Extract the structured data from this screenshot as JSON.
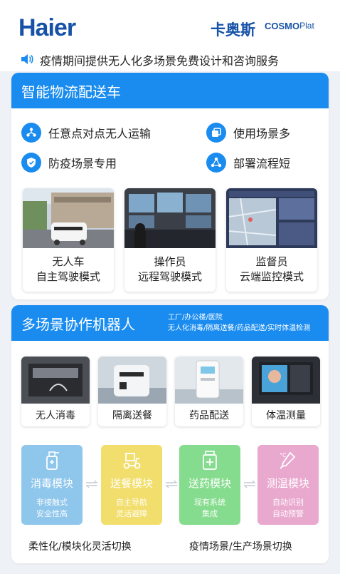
{
  "header": {
    "brand_left": "Haier",
    "brand_right_cn": "卡奥斯",
    "brand_right_en_a": "COSMO",
    "brand_right_en_b": "Plat"
  },
  "notice": {
    "icon": "speaker-icon",
    "text": "疫情期间提供无人化多场景免费设计和咨询服务"
  },
  "logistics": {
    "title": "智能物流配送车",
    "features": [
      {
        "label": "任意点对点无人运输",
        "icon": "network-icon"
      },
      {
        "label": "使用场景多",
        "icon": "copy-icon"
      },
      {
        "label": "防疫场景专用",
        "icon": "shield-icon"
      },
      {
        "label": "部署流程短",
        "icon": "share-icon"
      }
    ],
    "modes": [
      {
        "line1": "无人车",
        "line2": "自主驾驶模式"
      },
      {
        "line1": "操作员",
        "line2": "远程驾驶模式"
      },
      {
        "line1": "监督员",
        "line2": "云端监控模式"
      }
    ]
  },
  "robots": {
    "title": "多场景协作机器人",
    "sub_line1": "工厂/办公楼/医院",
    "sub_line2": "无人化消毒/隔离送餐/药品配送/实时体温检测",
    "items": [
      {
        "label": "无人消毒"
      },
      {
        "label": "隔离送餐"
      },
      {
        "label": "药品配送"
      },
      {
        "label": "体温测量"
      }
    ],
    "modules": [
      {
        "name": "消毒模块",
        "d1": "非接触式",
        "d2": "安全性高",
        "color": "#8fc6ec"
      },
      {
        "name": "送餐模块",
        "d1": "自主导航",
        "d2": "灵活避障",
        "color": "#f2de6c"
      },
      {
        "name": "送药模块",
        "d1": "现有系统",
        "d2": "集成",
        "color": "#86dc8e"
      },
      {
        "name": "测温模块",
        "d1": "自动识别",
        "d2": "自动预警",
        "color": "#e9a9cf"
      }
    ],
    "footer_left": "柔性化/模块化灵活切换",
    "footer_right": "疫情场景/生产场景切换"
  },
  "colors": {
    "accent_blue": "#1a8cf0",
    "brand_blue": "#1552a8"
  }
}
